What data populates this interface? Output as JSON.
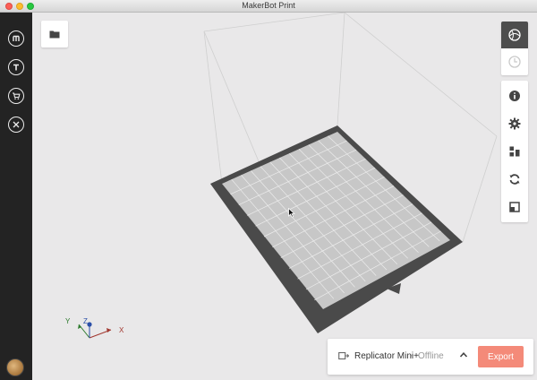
{
  "window": {
    "title": "MakerBot Print"
  },
  "sidebar": {
    "items": [
      {
        "icon": "makerbot-m-icon"
      },
      {
        "icon": "thingiverse-t-icon"
      },
      {
        "icon": "cart-icon"
      },
      {
        "icon": "tools-icon"
      }
    ],
    "avatar": "user-avatar"
  },
  "toolbar": {
    "view_buttons": [
      {
        "icon": "globe-view-icon",
        "active": true
      },
      {
        "icon": "print-time-icon",
        "active": false
      }
    ],
    "tools": [
      {
        "icon": "info-icon"
      },
      {
        "icon": "settings-gear-icon"
      },
      {
        "icon": "arrange-icon"
      },
      {
        "icon": "rotate-icon"
      },
      {
        "icon": "scale-icon"
      }
    ]
  },
  "axes": {
    "x": "X",
    "y": "Y",
    "z": "Z"
  },
  "printer": {
    "name": "Replicator Mini+",
    "separator": "•",
    "status": "Offline",
    "export_label": "Export"
  },
  "colors": {
    "export_button": "#f48a79",
    "sidebar": "#232323",
    "build_plate": "#c7c7c7",
    "plate_border": "#4a4a4a"
  }
}
